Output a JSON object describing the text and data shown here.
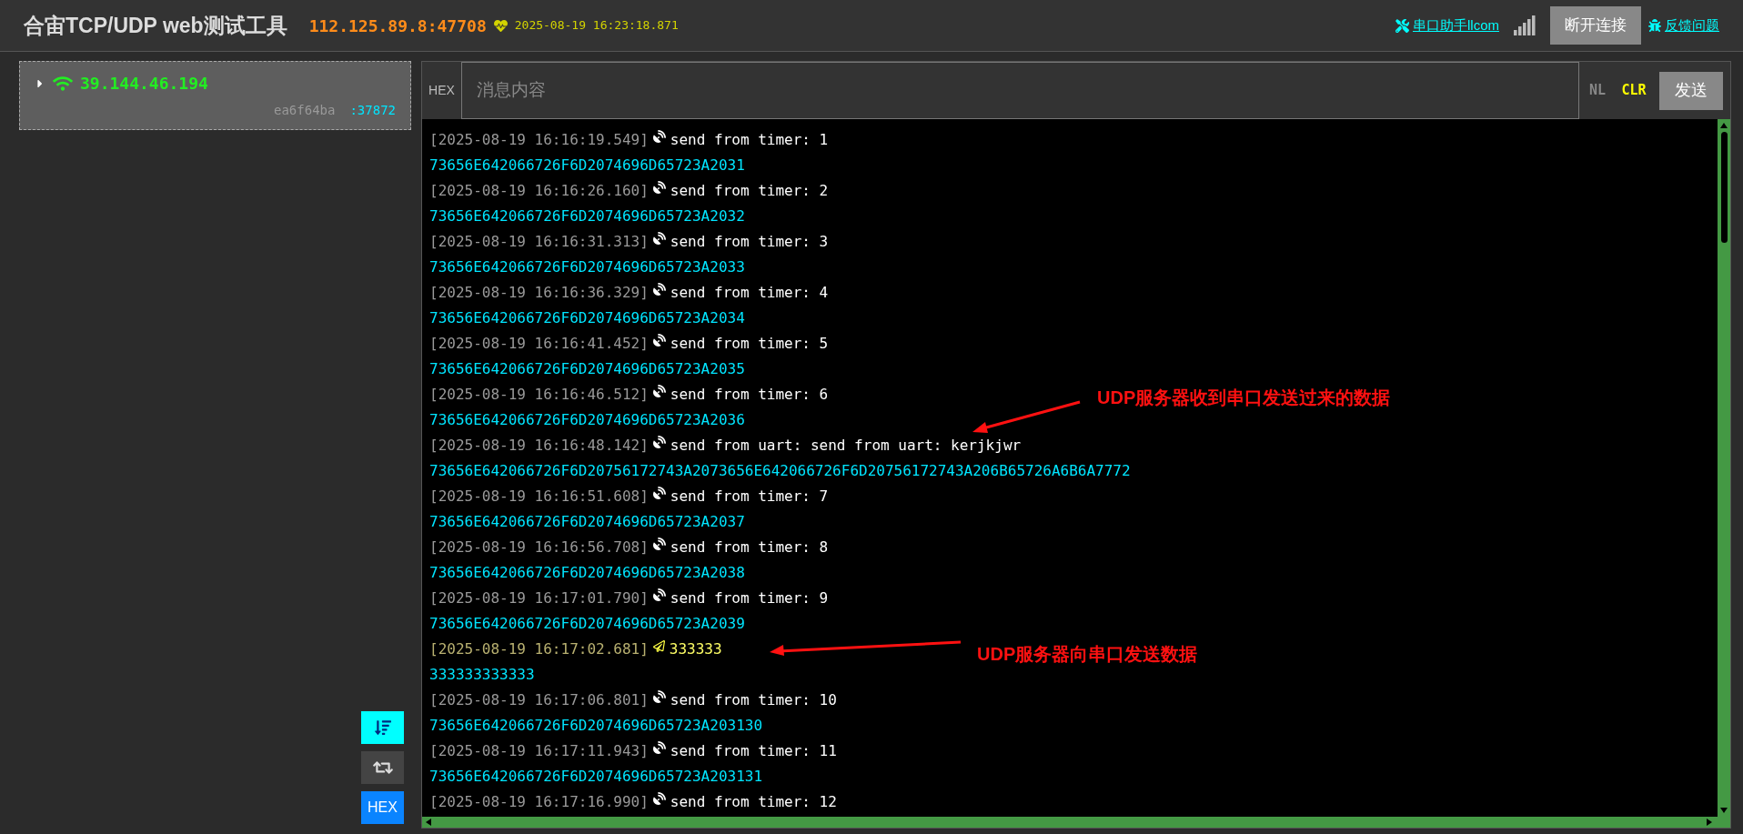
{
  "header": {
    "title": "合宙TCP/UDP web测试工具",
    "address": "112.125.89.8:47708",
    "timestamp": "2025-08-19 16:23:18.871",
    "links": [
      {
        "kind": "tools",
        "label": "串口助手llcom"
      },
      {
        "kind": "disconnect",
        "label": "断开连接"
      },
      {
        "kind": "feedback",
        "label": "反馈问题"
      }
    ]
  },
  "clients": [
    {
      "ip": "39.144.46.194",
      "id": "ea6f64ba",
      "port": ":37872",
      "expanded": false
    }
  ],
  "side_buttons": [
    {
      "kind": "autoscroll",
      "on": true
    },
    {
      "kind": "loop",
      "on": false
    },
    {
      "kind": "hex",
      "label": "HEX",
      "on": true
    }
  ],
  "composer": {
    "hex_label": "HEX",
    "placeholder": "消息内容",
    "nl": {
      "label": "NL",
      "on": false
    },
    "clr": {
      "label": "CLR",
      "on": true
    },
    "send": "发送"
  },
  "log": [
    {
      "kind": "recv",
      "time": "[2025-08-19 16:16:19.549]",
      "text": "send from timer: 1",
      "hex": "73656E642066726F6D2074696D65723A2031"
    },
    {
      "kind": "recv",
      "time": "[2025-08-19 16:16:26.160]",
      "text": "send from timer: 2",
      "hex": "73656E642066726F6D2074696D65723A2032"
    },
    {
      "kind": "recv",
      "time": "[2025-08-19 16:16:31.313]",
      "text": "send from timer: 3",
      "hex": "73656E642066726F6D2074696D65723A2033"
    },
    {
      "kind": "recv",
      "time": "[2025-08-19 16:16:36.329]",
      "text": "send from timer: 4",
      "hex": "73656E642066726F6D2074696D65723A2034"
    },
    {
      "kind": "recv",
      "time": "[2025-08-19 16:16:41.452]",
      "text": "send from timer: 5",
      "hex": "73656E642066726F6D2074696D65723A2035"
    },
    {
      "kind": "recv",
      "time": "[2025-08-19 16:16:46.512]",
      "text": "send from timer: 6",
      "hex": "73656E642066726F6D2074696D65723A2036"
    },
    {
      "kind": "recv",
      "time": "[2025-08-19 16:16:48.142]",
      "text": "send from uart: send from uart: kerjkjwr",
      "hex": "73656E642066726F6D20756172743A2073656E642066726F6D20756172743A206B65726A6B6A7772"
    },
    {
      "kind": "recv",
      "time": "[2025-08-19 16:16:51.608]",
      "text": "send from timer: 7",
      "hex": "73656E642066726F6D2074696D65723A2037"
    },
    {
      "kind": "recv",
      "time": "[2025-08-19 16:16:56.708]",
      "text": "send from timer: 8",
      "hex": "73656E642066726F6D2074696D65723A2038"
    },
    {
      "kind": "recv",
      "time": "[2025-08-19 16:17:01.790]",
      "text": "send from timer: 9",
      "hex": "73656E642066726F6D2074696D65723A2039"
    },
    {
      "kind": "send",
      "time": "[2025-08-19 16:17:02.681]",
      "text": "333333",
      "hex": "333333333333"
    },
    {
      "kind": "recv",
      "time": "[2025-08-19 16:17:06.801]",
      "text": "send from timer: 10",
      "hex": "73656E642066726F6D2074696D65723A203130"
    },
    {
      "kind": "recv",
      "time": "[2025-08-19 16:17:11.943]",
      "text": "send from timer: 11",
      "hex": "73656E642066726F6D2074696D65723A203131"
    },
    {
      "kind": "recv",
      "time": "[2025-08-19 16:17:16.990]",
      "text": "send from timer: 12"
    }
  ],
  "annotations": [
    "UDP服务器收到串口发送过来的数据",
    "UDP服务器向串口发送数据"
  ]
}
